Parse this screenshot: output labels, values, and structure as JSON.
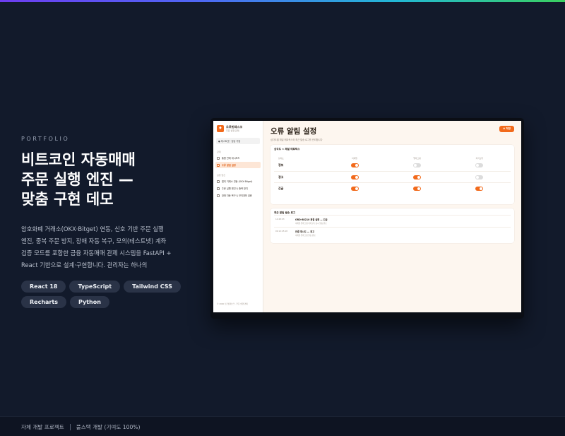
{
  "eyebrow": "PORTFOLIO",
  "headline": [
    "비트코인 자동매매",
    "주문 실행 엔진 —",
    "맞춤 구현 데모"
  ],
  "description": [
    "암호화폐 거래소(OKX·Bitget) 연동, 신호 기반 주문 실행",
    "엔진, 중복 주문 방지, 장애 자동 복구, 모의(테스트넷) 계좌",
    "검증 모드를 포함한 금융 자동매매 관제 시스템을 FastAPI +",
    "React 기반으로 설계·구현합니다. 관리자는 하나의"
  ],
  "tech_chips": [
    "React 18",
    "TypeScript",
    "Tailwind CSS",
    "Recharts",
    "Python"
  ],
  "footer": {
    "left": "자체 개발 프로젝트",
    "right": "풀스택 개발 (기여도 100%)"
  },
  "app": {
    "brand": {
      "name": "오르빗데스크",
      "sub": "주문 실행 관제"
    },
    "mode": "● 테스트넷 · 정상 가동",
    "sections": {
      "main": "관제",
      "ops": "실행 엔진"
    },
    "nav_main": [
      {
        "label": "통합 관제 대시보드",
        "active": false
      },
      {
        "label": "오류 알림 설정",
        "active": true
      }
    ],
    "nav_ops": [
      {
        "label": "멀티 거래소 연동 (OKX·Bitget)",
        "active": false
      },
      {
        "label": "주문 실행 엔진 & 중복 방지",
        "active": false
      },
      {
        "label": "장애 자동 복구 & 모의계좌 검증",
        "active": false
      }
    ],
    "side_footer": "© 2026 오르빗데스크 · 주문 실행 관제",
    "title": "오류 알림 설정",
    "subtitle": "심각도별 채널 매트릭스와 최근 발송 로그를 관리합니다",
    "save_label": "⊕ 저장",
    "matrix": {
      "title": "심각도 × 채널 매트릭스",
      "columns": [
        "심각도",
        "이메일",
        "텔레그램",
        "카카오톡"
      ],
      "rows": [
        {
          "level": "정보",
          "toggles": [
            true,
            false,
            false
          ]
        },
        {
          "level": "경고",
          "toggles": [
            true,
            true,
            false
          ]
        },
        {
          "level": "긴급",
          "toggles": [
            true,
            true,
            true
          ]
        }
      ]
    },
    "logs": {
      "title": "최근 알림 발송 로그",
      "items": [
        {
          "time": "14:28:03",
          "title": "ORD-88210 체결 실패 — 긴급",
          "desc": "이메일·텔레그램·카카오톡 동시 발송 완료"
        },
        {
          "time": "09:12:45:18",
          "title": "연결 재시도 — 경고",
          "desc": "이메일·텔레그램 발송 완료"
        }
      ]
    }
  }
}
